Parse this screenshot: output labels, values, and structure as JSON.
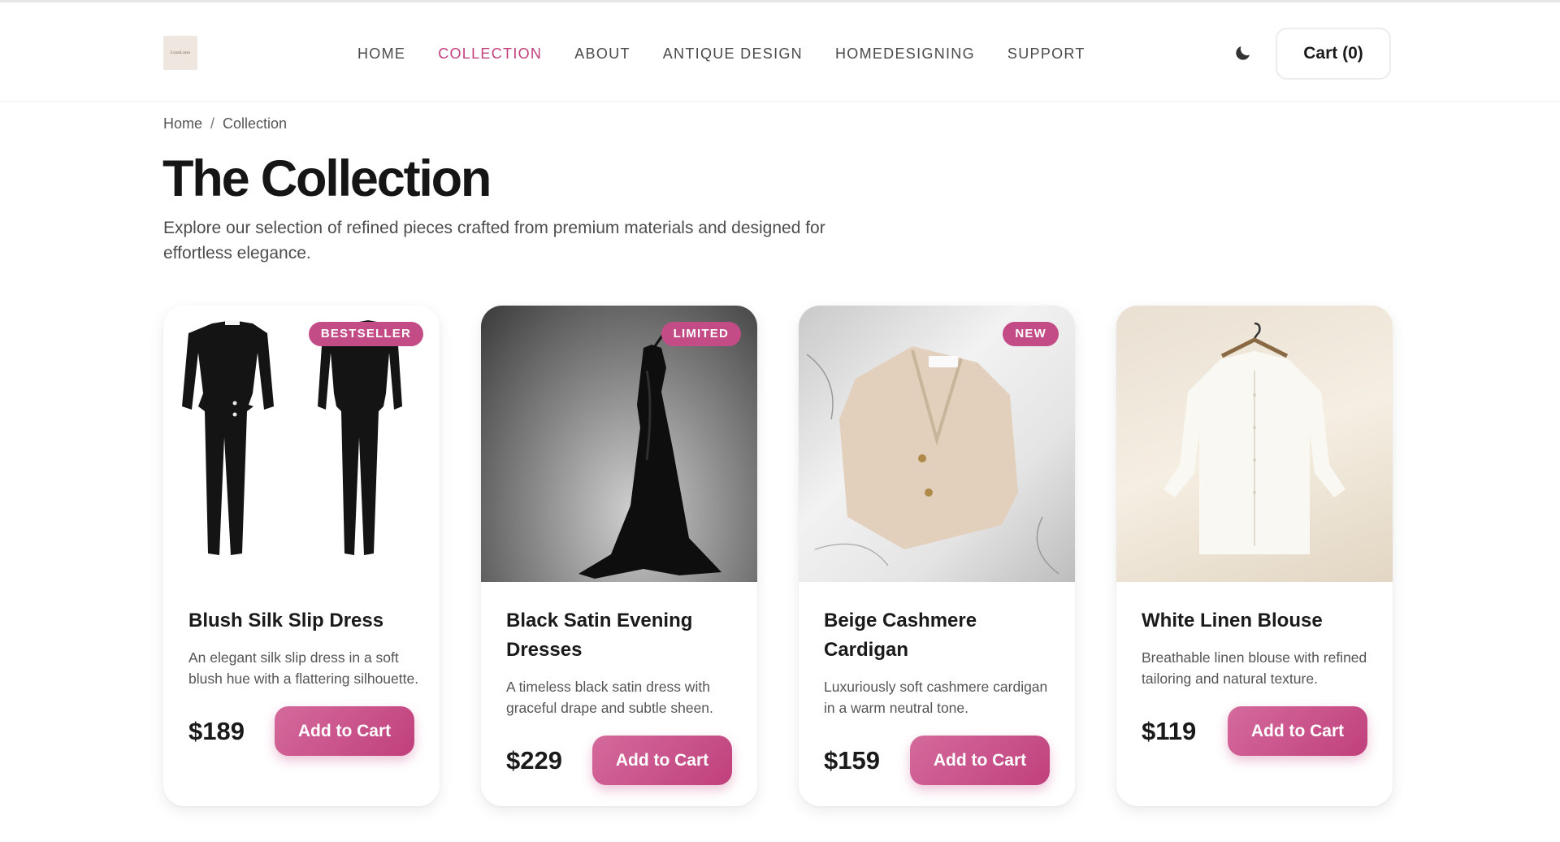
{
  "brand": {
    "logo_text": "LuxeLane"
  },
  "nav": {
    "items": [
      {
        "label": "HOME",
        "active": false
      },
      {
        "label": "COLLECTION",
        "active": true
      },
      {
        "label": "ABOUT",
        "active": false
      },
      {
        "label": "ANTIQUE DESIGN",
        "active": false
      },
      {
        "label": "HOMEDESIGNING",
        "active": false
      },
      {
        "label": "SUPPORT",
        "active": false
      }
    ]
  },
  "header": {
    "theme_icon": "moon-icon",
    "cart_label": "Cart (0)"
  },
  "breadcrumb": {
    "home": "Home",
    "separator": "/",
    "current": "Collection"
  },
  "page": {
    "title": "The Collection",
    "intro": "Explore our selection of refined pieces crafted from premium materials and designed for effortless elegance."
  },
  "products": [
    {
      "badge": "BESTSELLER",
      "title": "Blush Silk Slip Dress",
      "description": "An elegant silk slip dress in a soft blush hue with a flattering silhouette.",
      "price": "$189",
      "button": "Add to Cart"
    },
    {
      "badge": "LIMITED",
      "title": "Black Satin Evening Dresses",
      "description": "A timeless black satin dress with graceful drape and subtle sheen.",
      "price": "$229",
      "button": "Add to Cart"
    },
    {
      "badge": "NEW",
      "title": "Beige Cashmere Cardigan",
      "description": "Luxuriously soft cashmere cardigan in a warm neutral tone.",
      "price": "$159",
      "button": "Add to Cart"
    },
    {
      "badge": "",
      "title": "White Linen Blouse",
      "description": "Breathable linen blouse with refined tailoring and natural texture.",
      "price": "$119",
      "button": "Add to Cart"
    }
  ],
  "colors": {
    "accent": "#c44c86",
    "nav_active": "#c23f7e",
    "text": "#1a1a1a"
  }
}
